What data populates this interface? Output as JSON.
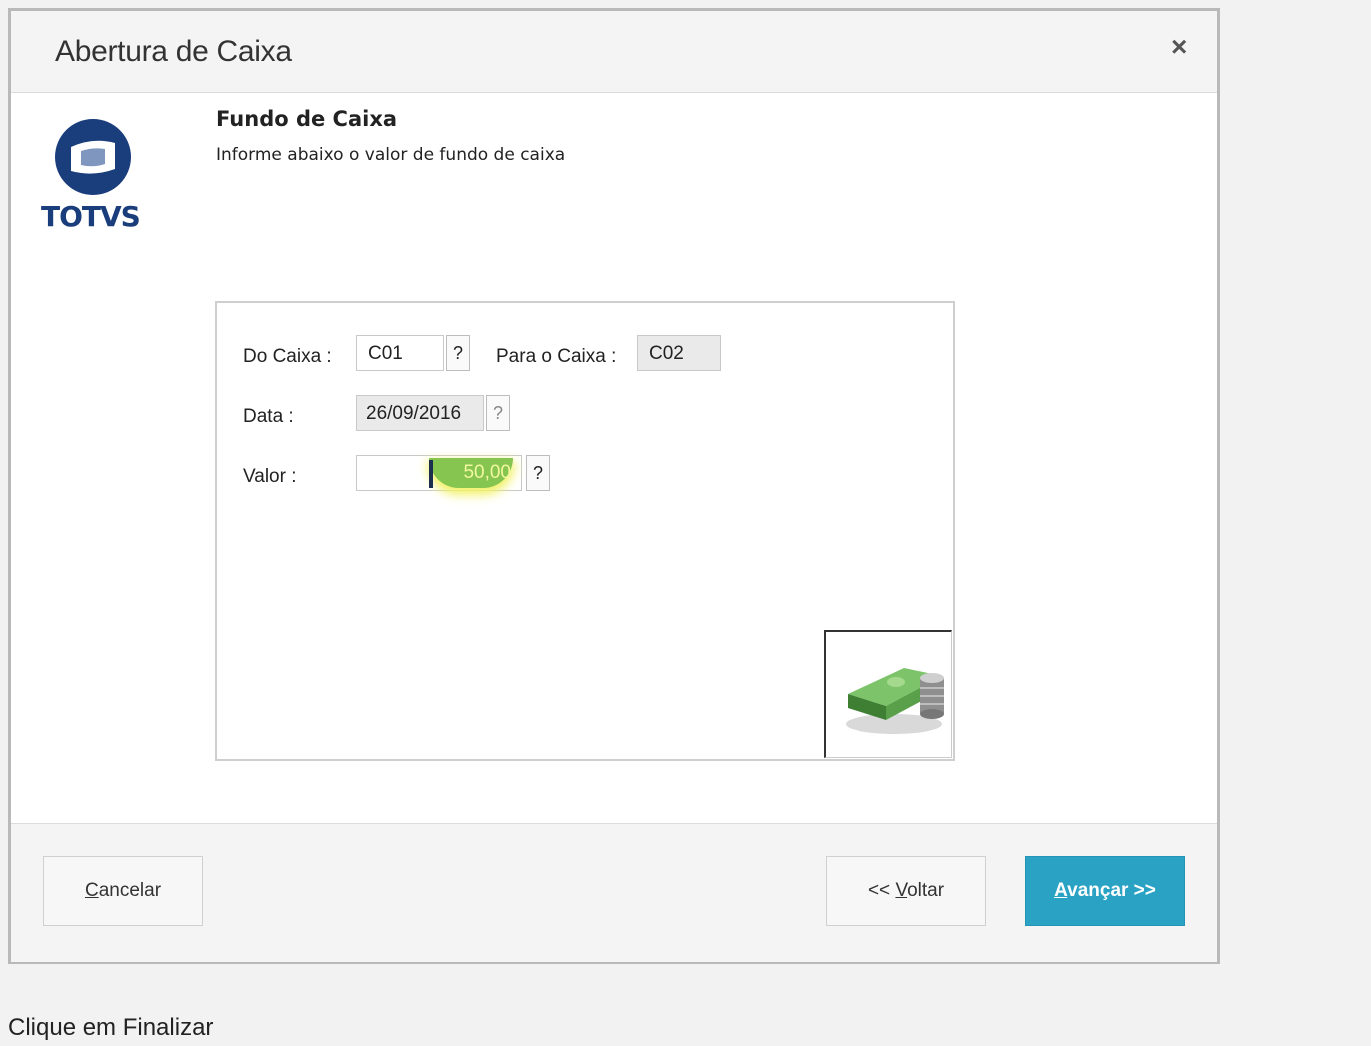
{
  "dialog": {
    "title": "Abertura de Caixa",
    "close_label": "×"
  },
  "logo": {
    "text": "TOTVS"
  },
  "step": {
    "title": "Fundo de Caixa",
    "subtitle": "Informe abaixo o valor de fundo de caixa"
  },
  "form": {
    "do_caixa_label": "Do Caixa :",
    "do_caixa_value": "C01",
    "para_caixa_label": "Para o Caixa :",
    "para_caixa_value": "C02",
    "data_label": "Data  :",
    "data_value": "26/09/2016",
    "valor_label": "Valor :",
    "valor_value": "50,00",
    "help_label": "?"
  },
  "buttons": {
    "cancel_accesskey": "C",
    "cancel_rest": "ancelar",
    "back_prefix": "<< ",
    "back_accesskey": "V",
    "back_rest": "oltar",
    "next_accesskey": "A",
    "next_rest": "vançar >>"
  },
  "caption": "Clique em Finalizar",
  "colors": {
    "primary_button": "#2aa2c4",
    "logo_blue": "#1a3d7c",
    "value_highlight": "#86c54f"
  }
}
